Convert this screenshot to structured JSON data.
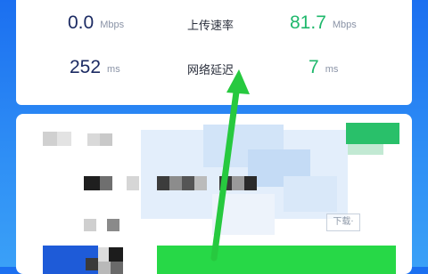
{
  "speed": {
    "download_value": "0.0",
    "download_unit": "Mbps",
    "upload_label": "上传速率",
    "upload_value": "81.7",
    "upload_unit": "Mbps",
    "latency_value": "252",
    "latency_unit": "ms",
    "latency_label": "网络延迟",
    "jitter_value": "7",
    "jitter_unit": "ms"
  },
  "watermark_text": "下载·",
  "colors": {
    "background": "#1b6ff0",
    "value_dark": "#1c2b63",
    "value_green": "#1fb86c",
    "highlight_green": "#27d847",
    "arrow_green": "#27c93f"
  }
}
